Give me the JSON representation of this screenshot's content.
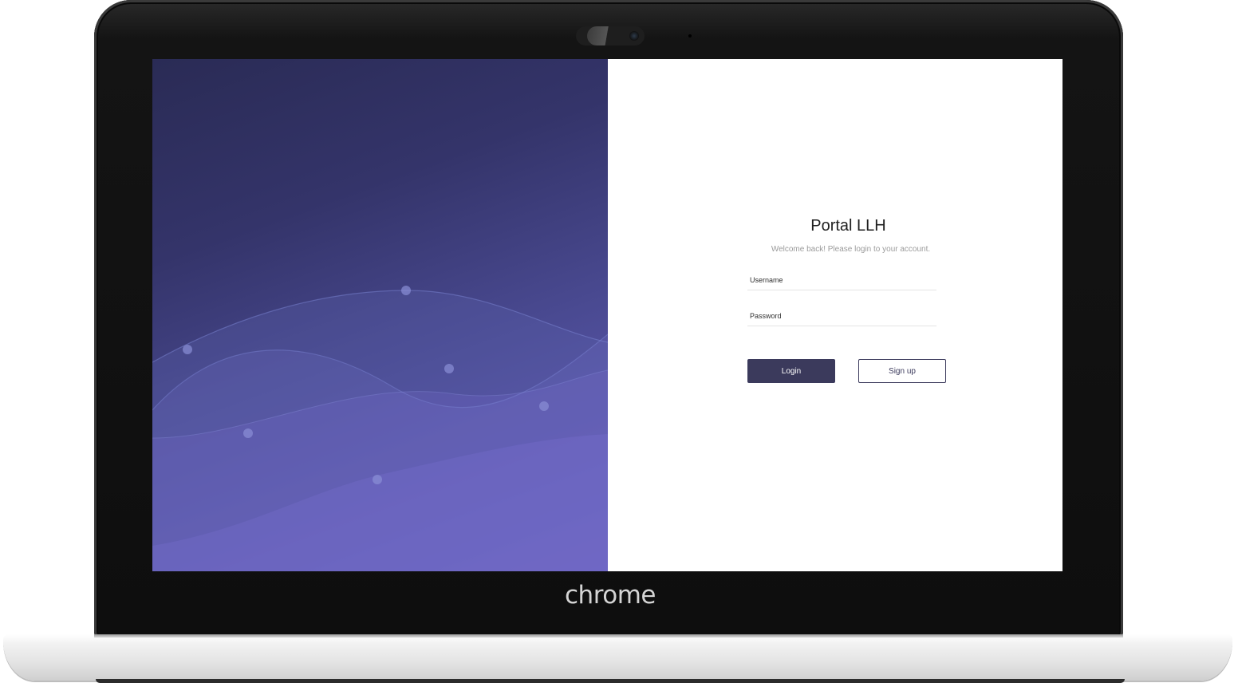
{
  "device": {
    "brand_logo": "chrome"
  },
  "login": {
    "title": "Portal LLH",
    "subtitle": "Welcome back! Please login to your account.",
    "username_placeholder": "Username",
    "password_placeholder": "Password",
    "login_label": "Login",
    "signup_label": "Sign up"
  },
  "colors": {
    "primary": "#3b3a5c",
    "hero_dark": "#2a2b55",
    "hero_light": "#6a5fc0"
  },
  "icons": {
    "camera": "webcam-icon"
  }
}
